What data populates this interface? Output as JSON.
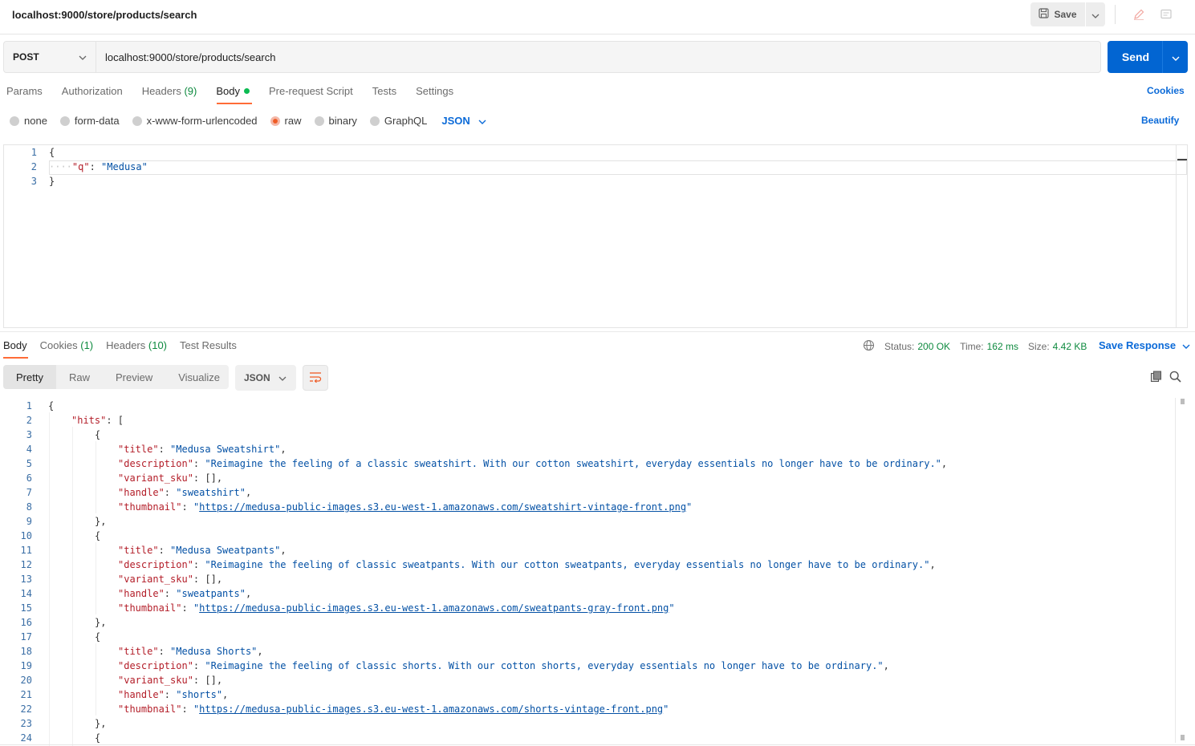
{
  "header": {
    "title": "localhost:9000/store/products/search",
    "save_label": "Save"
  },
  "request": {
    "method": "POST",
    "url": "localhost:9000/store/products/search",
    "send_label": "Send",
    "tabs": {
      "params": "Params",
      "authorization": "Authorization",
      "headers": "Headers",
      "headers_count": "(9)",
      "body": "Body",
      "pre_request": "Pre-request Script",
      "tests": "Tests",
      "settings": "Settings"
    },
    "cookies_label": "Cookies",
    "body_types": {
      "none": "none",
      "form_data": "form-data",
      "urlencoded": "x-www-form-urlencoded",
      "raw": "raw",
      "binary": "binary",
      "graphql": "GraphQL",
      "format": "JSON"
    },
    "beautify_label": "Beautify",
    "body_lines": {
      "n1": "1",
      "n2": "2",
      "n3": "3",
      "l1": "{",
      "l2_indent": "····",
      "l2_key": "\"q\"",
      "l2_sep": ": ",
      "l2_val": "\"Medusa\"",
      "l3": "}"
    }
  },
  "response": {
    "tabs": {
      "body": "Body",
      "cookies": "Cookies",
      "cookies_count": "(1)",
      "headers": "Headers",
      "headers_count": "(10)",
      "test_results": "Test Results"
    },
    "status_label": "Status:",
    "status_value": "200 OK",
    "time_label": "Time:",
    "time_value": "162 ms",
    "size_label": "Size:",
    "size_value": "4.42 KB",
    "save_response_label": "Save Response",
    "views": {
      "pretty": "Pretty",
      "raw": "Raw",
      "preview": "Preview",
      "visualize": "Visualize"
    },
    "format": "JSON",
    "line_numbers": [
      "1",
      "2",
      "3",
      "4",
      "5",
      "6",
      "7",
      "8",
      "9",
      "10",
      "11",
      "12",
      "13",
      "14",
      "15",
      "16",
      "17",
      "18",
      "19",
      "20",
      "21",
      "22",
      "23",
      "24"
    ],
    "json": {
      "open_brace": "{",
      "hits_key": "\"hits\"",
      "hits_open": ": [",
      "obj_open": "{",
      "obj_close": "},",
      "title_key": "\"title\"",
      "description_key": "\"description\"",
      "variant_key": "\"variant_sku\"",
      "handle_key": "\"handle\"",
      "thumbnail_key": "\"thumbnail\"",
      "empty_array": ": [],",
      "products": [
        {
          "title": "\"Medusa Sweatshirt\"",
          "description": "\"Reimagine the feeling of a classic sweatshirt. With our cotton sweatshirt, everyday essentials no longer have to be ordinary.\"",
          "handle": "\"sweatshirt\"",
          "thumbnail": "https://medusa-public-images.s3.eu-west-1.amazonaws.com/sweatshirt-vintage-front.png"
        },
        {
          "title": "\"Medusa Sweatpants\"",
          "description": "\"Reimagine the feeling of classic sweatpants. With our cotton sweatpants, everyday essentials no longer have to be ordinary.\"",
          "handle": "\"sweatpants\"",
          "thumbnail": "https://medusa-public-images.s3.eu-west-1.amazonaws.com/sweatpants-gray-front.png"
        },
        {
          "title": "\"Medusa Shorts\"",
          "description": "\"Reimagine the feeling of classic shorts. With our cotton shorts, everyday essentials no longer have to be ordinary.\"",
          "handle": "\"shorts\"",
          "thumbnail": "https://medusa-public-images.s3.eu-west-1.amazonaws.com/shorts-vintage-front.png"
        }
      ]
    }
  },
  "colors": {
    "accent": "#ff6c37",
    "send_blue": "#0265d2",
    "link_blue": "#0b6ad8",
    "status_green": "#0e8a3f",
    "json_key": "#b31d28",
    "json_string": "#0451a5"
  }
}
